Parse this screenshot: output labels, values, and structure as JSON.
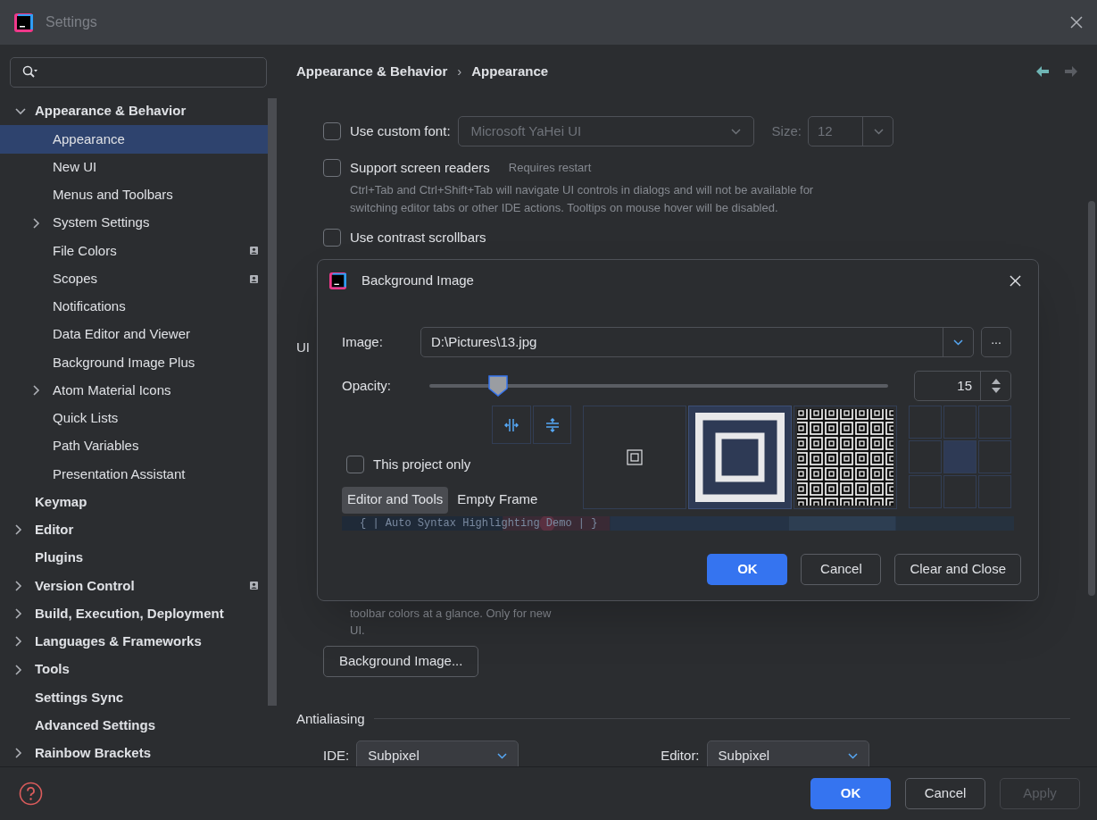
{
  "window": {
    "title": "Settings"
  },
  "sidebar": {
    "items": [
      {
        "label": "Appearance & Behavior",
        "kind": "group",
        "expanded": true,
        "selected": false,
        "badge": false,
        "children": [
          {
            "label": "Appearance",
            "kind": "leaf",
            "selected": true,
            "badge": false
          },
          {
            "label": "New UI",
            "kind": "leaf",
            "selected": false,
            "badge": false
          },
          {
            "label": "Menus and Toolbars",
            "kind": "leaf",
            "selected": false,
            "badge": false
          },
          {
            "label": "System Settings",
            "kind": "group",
            "expanded": false,
            "selected": false,
            "badge": false
          },
          {
            "label": "File Colors",
            "kind": "leaf",
            "selected": false,
            "badge": true
          },
          {
            "label": "Scopes",
            "kind": "leaf",
            "selected": false,
            "badge": true
          },
          {
            "label": "Notifications",
            "kind": "leaf",
            "selected": false,
            "badge": false
          },
          {
            "label": "Data Editor and Viewer",
            "kind": "leaf",
            "selected": false,
            "badge": false
          },
          {
            "label": "Background Image Plus",
            "kind": "leaf",
            "selected": false,
            "badge": false
          },
          {
            "label": "Atom Material Icons",
            "kind": "group",
            "expanded": false,
            "selected": false,
            "badge": false
          },
          {
            "label": "Quick Lists",
            "kind": "leaf",
            "selected": false,
            "badge": false
          },
          {
            "label": "Path Variables",
            "kind": "leaf",
            "selected": false,
            "badge": false
          },
          {
            "label": "Presentation Assistant",
            "kind": "leaf",
            "selected": false,
            "badge": false
          }
        ]
      },
      {
        "label": "Keymap",
        "kind": "leaf",
        "selected": false,
        "badge": false
      },
      {
        "label": "Editor",
        "kind": "group",
        "expanded": false,
        "selected": false,
        "badge": false
      },
      {
        "label": "Plugins",
        "kind": "leaf",
        "selected": false,
        "badge": false
      },
      {
        "label": "Version Control",
        "kind": "group",
        "expanded": false,
        "selected": false,
        "badge": true
      },
      {
        "label": "Build, Execution, Deployment",
        "kind": "group",
        "expanded": false,
        "selected": false,
        "badge": false
      },
      {
        "label": "Languages & Frameworks",
        "kind": "group",
        "expanded": false,
        "selected": false,
        "badge": false
      },
      {
        "label": "Tools",
        "kind": "group",
        "expanded": false,
        "selected": false,
        "badge": false
      },
      {
        "label": "Settings Sync",
        "kind": "leaf",
        "selected": false,
        "badge": false
      },
      {
        "label": "Advanced Settings",
        "kind": "leaf",
        "selected": false,
        "badge": false
      },
      {
        "label": "Rainbow Brackets",
        "kind": "group",
        "expanded": false,
        "selected": false,
        "badge": false
      }
    ]
  },
  "breadcrumb": [
    "Appearance & Behavior",
    "Appearance"
  ],
  "breadcrumb_separator": "›",
  "navigation": {
    "back_enabled": true,
    "forward_enabled": false
  },
  "content": {
    "custom_font": {
      "label": "Use custom font:",
      "checked": false,
      "font": "Microsoft YaHei UI",
      "size_label": "Size:",
      "size": "12",
      "disabled": true
    },
    "screen_readers": {
      "label": "Support screen readers",
      "checked": false,
      "note": "Requires restart",
      "description": "Ctrl+Tab and Ctrl+Shift+Tab will navigate UI controls in dialogs and will not be available for switching editor tabs or other IDE actions. Tooltips on mouse hover will be disabled."
    },
    "contrast_scrollbars": {
      "label": "Use contrast scrollbars",
      "checked": false
    },
    "section_partial": "UI",
    "new_ui_note": "toolbar colors at a glance. Only for new UI.",
    "background_button": "Background Image...",
    "antialiasing": {
      "title": "Antialiasing",
      "ide_label": "IDE:",
      "ide_value": "Subpixel",
      "editor_label": "Editor:",
      "editor_value": "Subpixel"
    }
  },
  "dialog": {
    "title": "Background Image",
    "image_label": "Image:",
    "image_value": "D:\\Pictures\\13.jpg",
    "browse": "...",
    "opacity_label": "Opacity:",
    "opacity": {
      "level": 0.15
    },
    "opacity_value": "15",
    "fill_modes": [
      {
        "kind": "center",
        "selected": false
      },
      {
        "kind": "scale",
        "selected": true
      },
      {
        "kind": "tile",
        "selected": false
      }
    ],
    "anchor": [
      {
        "selected": false
      },
      {
        "selected": false
      },
      {
        "selected": false
      },
      {
        "selected": false
      },
      {
        "selected": true
      },
      {
        "selected": false
      },
      {
        "selected": false
      },
      {
        "selected": false
      },
      {
        "selected": false
      }
    ],
    "project_only": {
      "label": "This project only",
      "checked": false
    },
    "targets": [
      {
        "label": "Editor and Tools",
        "selected": true
      },
      {
        "label": "Empty Frame",
        "selected": false
      }
    ],
    "preview_text": "{ | Auto Syntax Highlighting Demo | }",
    "buttons": [
      {
        "label": "OK",
        "kind": "primary"
      },
      {
        "label": "Cancel",
        "kind": "normal"
      },
      {
        "label": "Clear and Close",
        "kind": "normal"
      }
    ]
  },
  "footer": {
    "buttons": [
      {
        "label": "OK",
        "kind": "primary",
        "disabled": false
      },
      {
        "label": "Cancel",
        "kind": "normal",
        "disabled": false
      },
      {
        "label": "Apply",
        "kind": "normal",
        "disabled": true
      }
    ]
  }
}
